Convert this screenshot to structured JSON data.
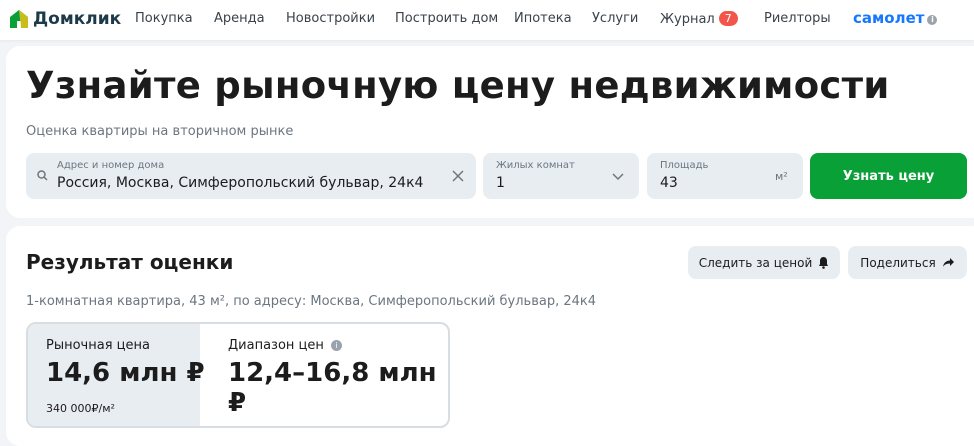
{
  "nav": {
    "logo": "Домклик",
    "items": [
      "Покупка",
      "Аренда",
      "Новостройки",
      "Построить дом",
      "Ипотека",
      "Услуги",
      "Журнал",
      "Риелторы"
    ],
    "journal_badge": "7",
    "partner": "самолет"
  },
  "hero": {
    "title": "Узнайте рыночную цену недвижимости",
    "subtitle": "Оценка квартиры на вторичном рынке"
  },
  "form": {
    "address_label": "Адрес и номер дома",
    "address_value": "Россия, Москва, Симферопольский бульвар, 24к4",
    "rooms_label": "Жилых комнат",
    "rooms_value": "1",
    "area_label": "Площадь",
    "area_value": "43",
    "area_unit": "м²",
    "submit": "Узнать цену"
  },
  "result": {
    "title": "Результат оценки",
    "follow": "Следить за ценой",
    "share": "Поделиться",
    "description": "1-комнатная квартира, 43 м², по адресу: Москва, Симферопольский бульвар, 24к4",
    "market_label": "Рыночная цена",
    "market_value": "14,6 млн ₽",
    "per_m2": "340 000₽/м²",
    "range_label": "Диапазон цен",
    "range_value": "12,4–16,8 млн ₽"
  },
  "colors": {
    "accent": "#0aa038",
    "badge": "#f4554a",
    "partner": "#1677ff"
  }
}
